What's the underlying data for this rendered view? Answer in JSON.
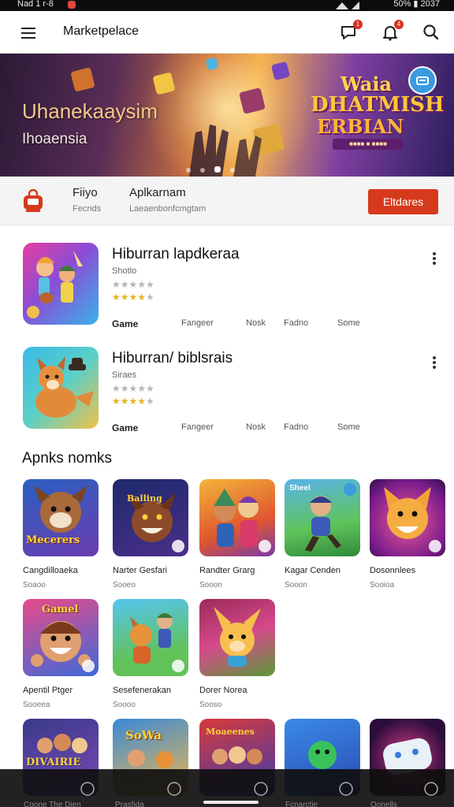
{
  "status_bar": {
    "left_text": "Nad 1 r-8",
    "right_text": "50% ▮ 2037"
  },
  "app_bar": {
    "title": "Marketpelace",
    "messages_badge": "1",
    "notifications_badge": "4"
  },
  "banner": {
    "title": "Uhanekaaysim",
    "subtitle": "Ihoaensia",
    "logo_lines": [
      "Waia",
      "DHATMISH",
      "ERBIAN",
      "■■■■ ■ ■■■■"
    ],
    "carousel_pages": 5,
    "carousel_active": 3
  },
  "info_row": {
    "item1_label": "Fiiyo",
    "item1_sub": "Fecnds",
    "item2_label": "Aplkarnam",
    "item2_sub": "Laeaenbonfcmgtam",
    "button_label": "Eltdares"
  },
  "featured": [
    {
      "name": "Hiburran lapdkeraa",
      "sub": "Shotlo",
      "rating_faint": "★★★★★",
      "rating_stars": 4,
      "tags": [
        "Game",
        "Fangeer",
        "Nosk",
        "Fadno",
        "Some"
      ]
    },
    {
      "name": "Hiburran/ biblsrais",
      "sub": "Siraes",
      "rating_faint": "★★★★★",
      "rating_stars": 4,
      "tags": [
        "Game",
        "Fangeer",
        "Nosk",
        "Fadno",
        "Some"
      ]
    }
  ],
  "section_title": "Apnks nomks",
  "grid": [
    {
      "name": "Cangdilloaeka",
      "sub": "Soaoo",
      "art_text": "Mecerers"
    },
    {
      "name": "Narter Gesfari",
      "sub": "Sooeo",
      "art_text": "Balling"
    },
    {
      "name": "Randter Grarg",
      "sub": "Sooon",
      "art_text": ""
    },
    {
      "name": "Kagar Cenden",
      "sub": "Sooon",
      "art_text": "Sheel"
    },
    {
      "name": "Dosonnlees",
      "sub": "Sooioa",
      "art_text": ""
    },
    {
      "name": "Apentil Ptger",
      "sub": "Sooeea",
      "art_text": "Gamel"
    },
    {
      "name": "Sesefenerakan",
      "sub": "Soooo",
      "art_text": ""
    },
    {
      "name": "Dorer Norea",
      "sub": "Sooso",
      "art_text": ""
    }
  ],
  "bottom_row": [
    {
      "art_text": "DIVAIRIE"
    },
    {
      "art_text": "SoWa"
    },
    {
      "art_text": "Moaeenes"
    },
    {
      "art_text": ""
    },
    {
      "art_text": ""
    }
  ],
  "nav": {
    "captions": [
      "Coone The Dien",
      "Prasfida",
      "Fcnarctie",
      "Oonells"
    ]
  }
}
